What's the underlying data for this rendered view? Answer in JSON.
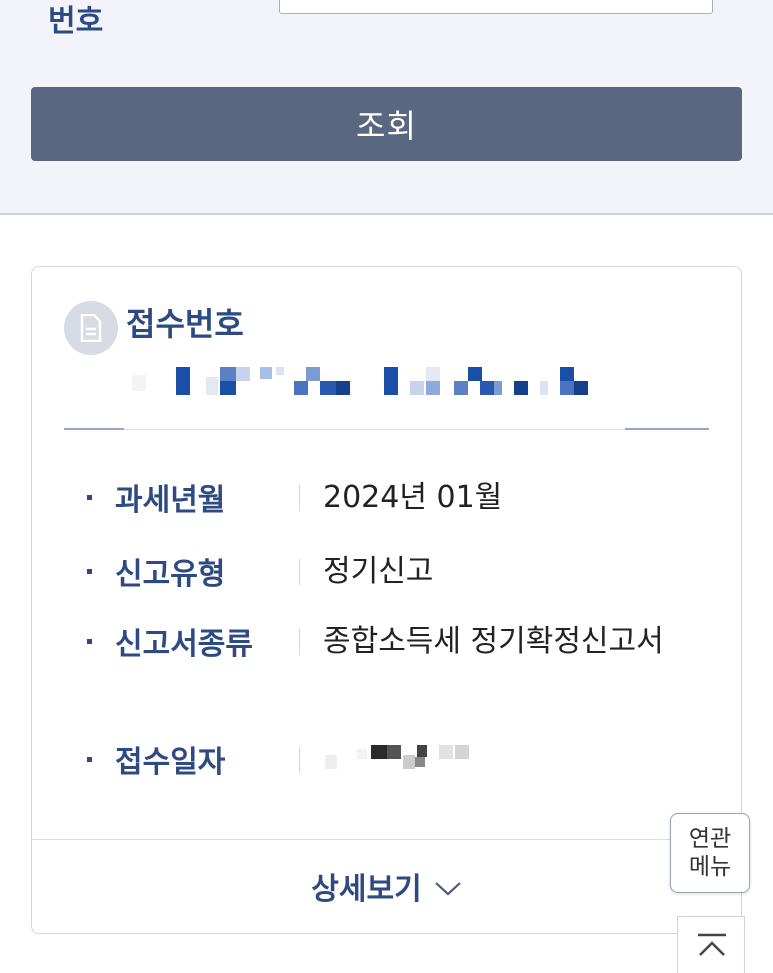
{
  "search": {
    "field_label": "번호",
    "input_value": "",
    "button_label": "조회"
  },
  "card": {
    "title": "접수번호",
    "receipt_number_masked": true,
    "rows": [
      {
        "label": "과세년월",
        "value": "2024년 01월"
      },
      {
        "label": "신고유형",
        "value": "정기신고"
      },
      {
        "label": "신고서종류",
        "value": "종합소득세 정기확정신고서"
      },
      {
        "label": "접수일자",
        "value": ""
      }
    ],
    "detail_button": "상세보기"
  },
  "floating": {
    "related_menu_line1": "연관",
    "related_menu_line2": "메뉴"
  },
  "icons": {
    "document": "document-icon",
    "chevron": "chevron-down-icon",
    "to_top": "chevron-up-icon"
  },
  "colors": {
    "accent": "#2e4a82",
    "button": "#5a6781",
    "top_bg": "#f2f4fa"
  }
}
